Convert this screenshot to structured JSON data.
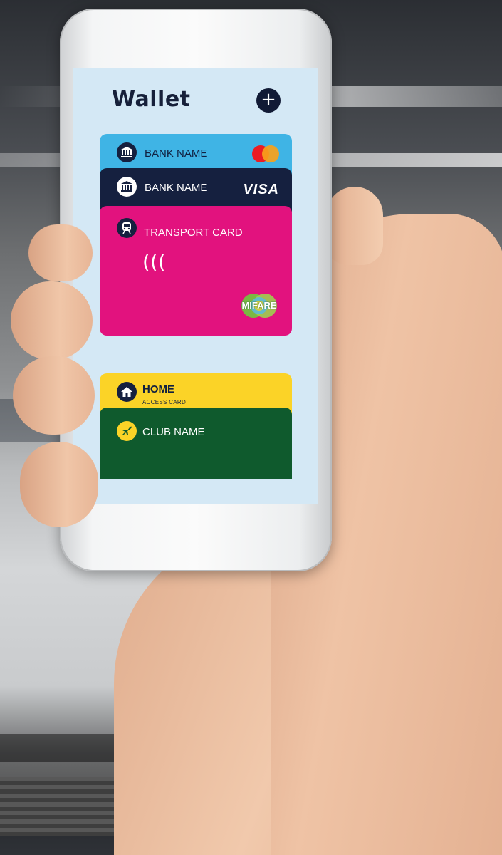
{
  "wallet": {
    "title": "Wallet",
    "add_button": "+"
  },
  "cards": [
    {
      "label": "BANK NAME",
      "icon": "bank-icon",
      "network": "mastercard-logo",
      "color": "#3fb4e5"
    },
    {
      "label": "BANK NAME",
      "icon": "bank-icon",
      "network_text": "VISA",
      "color": "#15203f"
    },
    {
      "label": "TRANSPORT CARD",
      "icon": "train-icon",
      "contactless": "(((",
      "badge_text": "MIFARE",
      "color": "#e2127e"
    },
    {
      "label": "HOME",
      "sublabel": "ACCESS CARD",
      "icon": "home-icon",
      "color": "#fbd327"
    },
    {
      "label": "CLUB NAME",
      "icon": "plane-icon",
      "color": "#0f5a2d"
    }
  ]
}
